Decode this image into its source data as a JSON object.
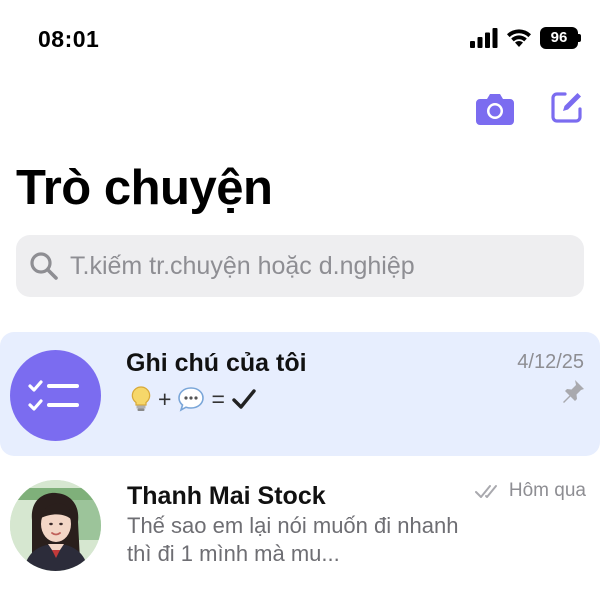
{
  "status_bar": {
    "time": "08:01",
    "battery_level": "96"
  },
  "header": {
    "title": "Trò chuyện",
    "actions": [
      {
        "icon": "camera-icon"
      },
      {
        "icon": "compose-icon"
      }
    ]
  },
  "search": {
    "placeholder": "T.kiếm tr.chuyện hoặc d.nghiệp"
  },
  "conversations": [
    {
      "name": "Ghi chú của tôi",
      "preview_icons": [
        "lightbulb-icon",
        "speech-bubble-icon",
        "checkmark-icon"
      ],
      "preview_plus": "+",
      "preview_equals": "=",
      "date": "4/12/25",
      "pinned": true,
      "highlighted": true
    },
    {
      "name": "Thanh Mai Stock",
      "preview": "Thế sao em lại nói muốn đi nhanh thì đi 1 mình  mà mu...",
      "date": "Hôm qua",
      "read_status_icon": "double-check-icon"
    }
  ],
  "colors": {
    "accent": "#7b6cf0",
    "highlight_row": "#e7eefe",
    "search_bg": "#eeeef0",
    "secondary_text": "#8e8e93"
  }
}
